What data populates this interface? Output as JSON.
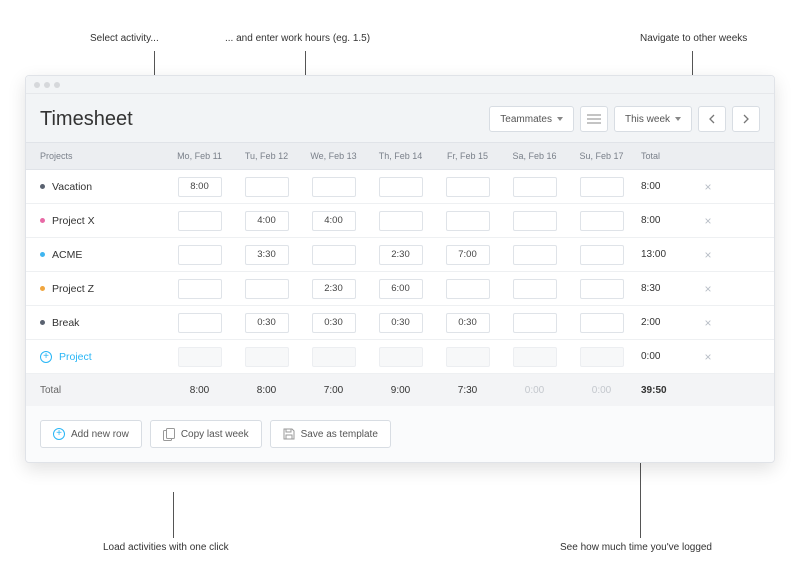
{
  "annotations": {
    "select_activity": "Select activity...",
    "enter_hours": "... and enter work hours (eg. 1.5)",
    "nav_weeks": "Navigate to other weeks",
    "load_click": "Load activities with one click",
    "see_time": "See how much time you've logged"
  },
  "header": {
    "title": "Timesheet",
    "teammates": "Teammates",
    "range": "This week"
  },
  "columns": {
    "projects": "Projects",
    "days": [
      "Mo, Feb 11",
      "Tu, Feb 12",
      "We, Feb 13",
      "Th, Feb 14",
      "Fr, Feb 15",
      "Sa, Feb 16",
      "Su, Feb 17"
    ],
    "total": "Total"
  },
  "rows": [
    {
      "name": "Vacation",
      "color": "#5a6270",
      "cells": [
        "8:00",
        "",
        "",
        "",
        "",
        "",
        ""
      ],
      "total": "8:00"
    },
    {
      "name": "Project X",
      "color": "#e86aa6",
      "cells": [
        "",
        "4:00",
        "4:00",
        "",
        "",
        "",
        ""
      ],
      "total": "8:00"
    },
    {
      "name": "ACME",
      "color": "#3fb5f0",
      "cells": [
        "",
        "3:30",
        "",
        "2:30",
        "7:00",
        "",
        ""
      ],
      "total": "13:00"
    },
    {
      "name": "Project Z",
      "color": "#f0a63f",
      "cells": [
        "",
        "",
        "2:30",
        "6:00",
        "",
        "",
        ""
      ],
      "total": "8:30"
    },
    {
      "name": "Break",
      "color": "#5a6270",
      "cells": [
        "",
        "0:30",
        "0:30",
        "0:30",
        "0:30",
        "",
        ""
      ],
      "total": "2:00"
    }
  ],
  "addrow": {
    "label": "Project",
    "total": "0:00"
  },
  "totals": {
    "label": "Total",
    "days": [
      "8:00",
      "8:00",
      "7:00",
      "9:00",
      "7:30",
      "0:00",
      "0:00"
    ],
    "grand": "39:50"
  },
  "footer": {
    "add": "Add new row",
    "copy": "Copy last week",
    "save": "Save as template"
  }
}
